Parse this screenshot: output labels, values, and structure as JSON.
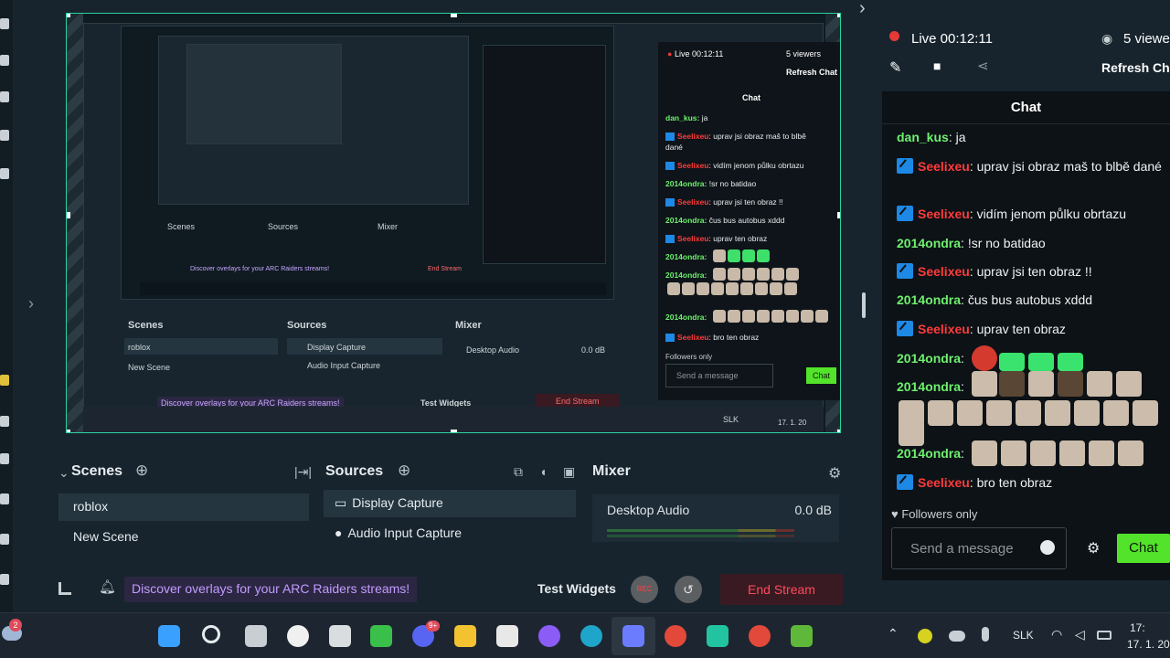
{
  "stream": {
    "live_label": "Live 00:12:11",
    "viewers": "5 viewers",
    "refresh_chat": "Refresh Chat"
  },
  "chat": {
    "title": "Chat",
    "messages": [
      {
        "user": "dan_kus",
        "text": "ja"
      },
      {
        "user": "Seelixeu",
        "text": "uprav jsi obraz maš to blbě dané"
      },
      {
        "user": "Seelixeu",
        "text": "vidím jenom půlku obrtazu"
      },
      {
        "user": "2014ondra",
        "text": "!sr no batidao"
      },
      {
        "user": "Seelixeu",
        "text": "uprav jsi ten obraz !!"
      },
      {
        "user": "2014ondra",
        "text": "čus bus autobus xddd"
      },
      {
        "user": "Seelixeu",
        "text": "uprav ten obraz"
      },
      {
        "user": "2014ondra",
        "text": ""
      },
      {
        "user": "2014ondra",
        "text": ""
      },
      {
        "user": "2014ondra",
        "text": ""
      },
      {
        "user": "Seelixeu",
        "text": "bro ten obraz"
      }
    ],
    "followers_only": "Followers only",
    "send_placeholder": "Send a message",
    "send_button": "Chat"
  },
  "dock": {
    "scenes_title": "Scenes",
    "scenes": [
      "roblox",
      "New Scene"
    ],
    "sources_title": "Sources",
    "sources": [
      "Display Capture",
      "Audio Input Capture"
    ],
    "mixer_title": "Mixer",
    "mixer": {
      "name": "Desktop Audio",
      "level": "0.0 dB"
    }
  },
  "bottom_bar": {
    "promo": "Discover overlays for your ARC Raiders streams!",
    "test_widgets": "Test Widgets",
    "rec": "REC",
    "end_stream": "End Stream"
  },
  "preview_mini": {
    "live": "Live 00:12:11",
    "viewers": "5 viewers",
    "refresh": "Refresh Chat",
    "chat": "Chat",
    "scenes": "Scenes",
    "sources": "Sources",
    "mixer": "Mixer",
    "roblox": "roblox",
    "new_scene": "New Scene",
    "display_capture": "Display Capture",
    "audio_input": "Audio Input Capture",
    "desktop_audio": "Desktop Audio",
    "db": "0.0 dB",
    "promo": "Discover overlays for your ARC Raiders streams!",
    "test_widgets": "Test Widgets",
    "end_stream": "End Stream",
    "send": "Send a message",
    "chat_btn": "Chat",
    "followers": "Followers only",
    "slk": "SLK",
    "date": "17. 1. 20"
  },
  "taskbar": {
    "notification_count": "2",
    "discord_badge": "9+",
    "language": "SLK",
    "time": "17:",
    "date": "17. 1. 20"
  },
  "colors": {
    "accent_green": "#52e32a",
    "username_green": "#6ef06e",
    "username_red": "#ff3b3b",
    "live_red": "#e53935",
    "preview_border": "#29d3a0"
  }
}
